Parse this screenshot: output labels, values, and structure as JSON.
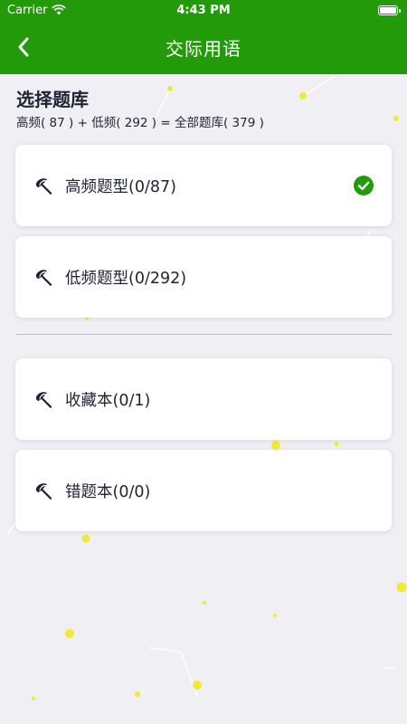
{
  "status_bar": {
    "carrier": "Carrier",
    "time": "4:43 PM"
  },
  "nav": {
    "title": "交际用语",
    "back_icon": "chevron-left-icon"
  },
  "section": {
    "title": "选择题库",
    "summary": "高频( 87 ) + 低频( 292 ) = 全部题库( 379 )"
  },
  "banks": [
    {
      "label": "高频题型(0/87)",
      "icon": "umbrella-icon",
      "selected": true
    },
    {
      "label": "低频题型(0/292)",
      "icon": "umbrella-icon",
      "selected": false
    },
    {
      "label": "收藏本(0/1)",
      "icon": "umbrella-icon",
      "selected": false
    },
    {
      "label": "错题本(0/0)",
      "icon": "umbrella-icon",
      "selected": false
    }
  ],
  "colors": {
    "brand_green": "#239a0a",
    "page_bg": "#efeff4",
    "divider": "#a8cfa0"
  }
}
